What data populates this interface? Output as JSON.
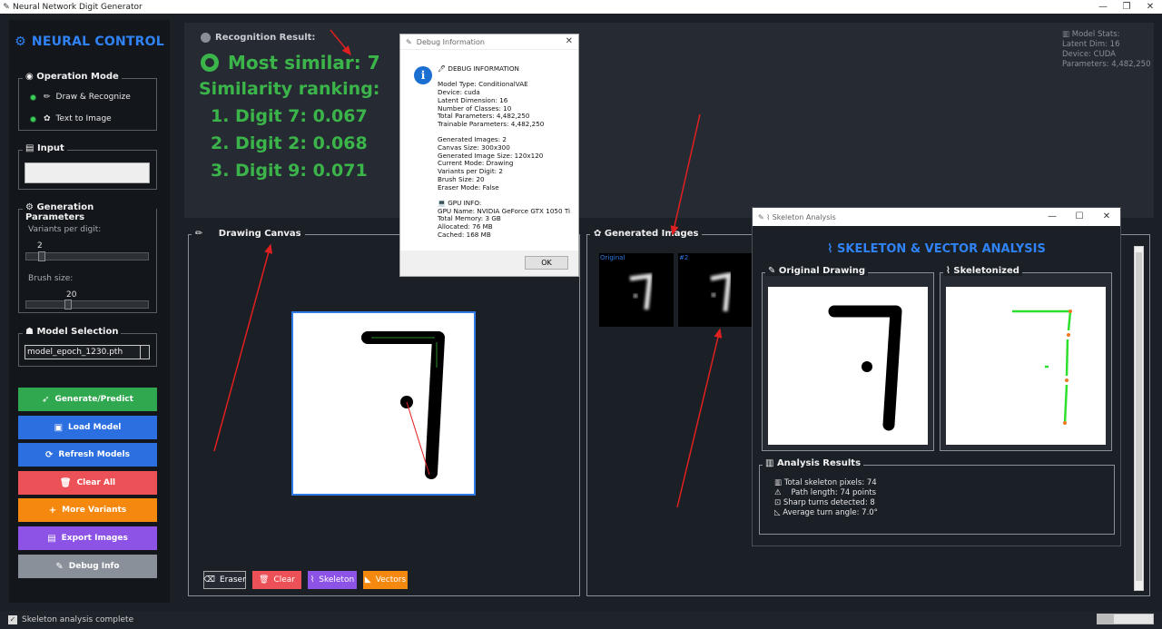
{
  "window": {
    "title": "Neural Network Digit Generator",
    "controls": [
      "—",
      "❐",
      "✕"
    ]
  },
  "sidebar": {
    "brand": "NEURAL CONTROL",
    "operation_mode": {
      "title": "Operation Mode",
      "options": [
        "Draw & Recognize",
        "Text to Image"
      ]
    },
    "input": {
      "title": "Input",
      "value": ""
    },
    "generation": {
      "title": "Generation Parameters",
      "variants_label": "Variants per digit:",
      "variants_value": "2",
      "variants_fraction": 0.1,
      "brush_label": "Brush size:",
      "brush_value": "20",
      "brush_fraction": 0.33
    },
    "model": {
      "title": "Model Selection",
      "selected": "model_epoch_1230.pth"
    },
    "buttons": {
      "generate": "Generate/Predict",
      "load": "Load Model",
      "refresh": "Refresh Models",
      "clear": "Clear All",
      "more": "More Variants",
      "export": "Export Images",
      "debug": "Debug Info"
    }
  },
  "result": {
    "label": "Recognition Result:",
    "most_similar": "Most similar: 7",
    "ranking_title": "Similarity ranking:",
    "ranking": [
      "1. Digit 7: 0.067",
      "2. Digit 2: 0.068",
      "3. Digit 9: 0.071"
    ],
    "stats": [
      "Model Stats:",
      "Latent Dim: 16",
      "Device: CUDA",
      "Parameters: 4,482,250"
    ]
  },
  "canvas": {
    "title": "Drawing Canvas",
    "tools": {
      "eraser": "Eraser",
      "clear": "Clear",
      "skeleton": "Skeleton",
      "vectors": "Vectors"
    }
  },
  "generated": {
    "title": "Generated Images",
    "thumbs": [
      "Original",
      "#2"
    ]
  },
  "debug": {
    "title": "Debug Information",
    "text": "🖊 DEBUG INFORMATION\n\nModel Type: ConditionalVAE\nDevice: cuda\nLatent Dimension: 16\nNumber of Classes: 10\nTotal Parameters: 4,482,250\nTrainable Parameters: 4,482,250\n\nGenerated Images: 2\nCanvas Size: 300x300\nGenerated Image Size: 120x120\nCurrent Mode: Drawing\nVariants per Digit: 2\nBrush Size: 20\nEraser Mode: False\n\n💻 GPU INFO:\nGPU Name: NVIDIA GeForce GTX 1050 Ti\nTotal Memory: 3 GB\nAllocated: 76 MB\nCached: 168 MB",
    "ok": "OK"
  },
  "skeleton": {
    "window_title": "Skeleton Analysis",
    "heading": "SKELETON & VECTOR ANALYSIS",
    "original": "Original Drawing",
    "skeletonized": "Skeletonized",
    "analysis_title": "Analysis Results",
    "results": [
      "Total skeleton pixels: 74",
      "Path length: 74 points",
      "Sharp turns detected: 8",
      "Average turn angle: 7.0°"
    ]
  },
  "status": {
    "text": "Skeleton analysis complete",
    "progress_fraction": 0.3
  },
  "colors": {
    "brand": "#2f83f6",
    "result_green": "#3bb54a",
    "generate": "#2fa84f",
    "load": "#2c6fe0",
    "refresh": "#2c6fe0",
    "clear": "#ec5157",
    "more": "#f5890f",
    "export": "#8d53e6",
    "debug": "#8a9099",
    "annotation_red": "#e02020"
  }
}
